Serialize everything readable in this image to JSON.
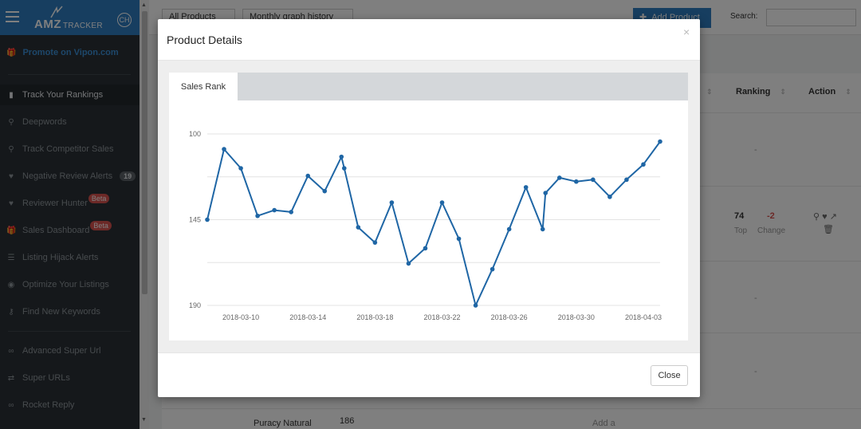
{
  "sidebar": {
    "brand": "AMZ",
    "brand_suffix": "TRACKER",
    "user_initials": "CH",
    "promote": "Promote on Vipon.com",
    "items": [
      {
        "label": "Track Your Rankings",
        "icon": "bar-chart-icon"
      },
      {
        "label": "Deepwords",
        "icon": "search-icon"
      },
      {
        "label": "Track Competitor Sales",
        "icon": "search-icon"
      },
      {
        "label": "Negative Review Alerts",
        "icon": "heart-icon",
        "count": "19"
      },
      {
        "label": "Reviewer Hunter",
        "icon": "heart-icon",
        "badge": "Beta"
      },
      {
        "label": "Sales Dashboard",
        "icon": "gift-icon",
        "badge": "Beta"
      },
      {
        "label": "Listing Hijack Alerts",
        "icon": "list-icon"
      },
      {
        "label": "Optimize Your Listings",
        "icon": "eye-icon"
      },
      {
        "label": "Find New Keywords",
        "icon": "key-icon"
      },
      {
        "label": "Advanced Super Url",
        "icon": "link-icon"
      },
      {
        "label": "Super URLs",
        "icon": "shuffle-icon"
      },
      {
        "label": "Rocket Reply",
        "icon": "link-icon"
      }
    ]
  },
  "page": {
    "filter_products": "All Products",
    "filter_graph": "Monthly graph history",
    "add_product": "Add Product",
    "search_label": "Search:",
    "col_ranking": "Ranking",
    "col_action": "Action",
    "rank_top_value": "74",
    "rank_top_label": "Top",
    "rank_change_value": "-2",
    "rank_change_label": "Change",
    "product_name": "Puracy Natural",
    "product_value": "186",
    "add_a": "Add a",
    "empty_cell": "-"
  },
  "modal": {
    "title": "Product Details",
    "close_x": "×",
    "tab": "Sales Rank",
    "close_button": "Close"
  },
  "colors": {
    "line": "#1f66a5",
    "sidebar_bg": "#2b3136",
    "header_blue": "#2e7cc0",
    "beta_red": "#d9534f"
  },
  "chart_data": {
    "type": "line",
    "title": "",
    "xlabel": "",
    "ylabel": "",
    "y_axis": "reversed",
    "ylim": [
      100,
      190
    ],
    "yticks": [
      100,
      145,
      190
    ],
    "grid": true,
    "xtick_labels": [
      "2018-03-10",
      "2018-03-14",
      "2018-03-18",
      "2018-03-22",
      "2018-03-26",
      "2018-03-30",
      "2018-04-03"
    ],
    "x": [
      "2018-03-08 00:00",
      "2018-03-09 00:00",
      "2018-03-10 00:00",
      "2018-03-11 00:00",
      "2018-03-12 00:00",
      "2018-03-13 00:00",
      "2018-03-14 00:00",
      "2018-03-15 00:00",
      "2018-03-16 00:00",
      "2018-03-16 04:00",
      "2018-03-17 00:00",
      "2018-03-18 00:00",
      "2018-03-19 00:00",
      "2018-03-20 00:00",
      "2018-03-21 00:00",
      "2018-03-22 00:00",
      "2018-03-23 00:00",
      "2018-03-24 00:00",
      "2018-03-25 00:00",
      "2018-03-26 00:00",
      "2018-03-27 00:00",
      "2018-03-28 00:00",
      "2018-03-28 04:00",
      "2018-03-29 00:00",
      "2018-03-30 00:00",
      "2018-03-31 00:00",
      "2018-04-01 00:00",
      "2018-04-02 00:00",
      "2018-04-03 00:00",
      "2018-04-04 00:00"
    ],
    "series": [
      {
        "values": [
          145,
          108,
          118,
          143,
          140,
          141,
          122,
          130,
          112,
          118,
          149,
          157,
          136,
          168,
          160,
          136,
          155,
          190,
          171,
          150,
          128,
          150,
          131,
          123,
          125,
          124,
          133,
          124,
          116,
          104
        ]
      }
    ]
  }
}
